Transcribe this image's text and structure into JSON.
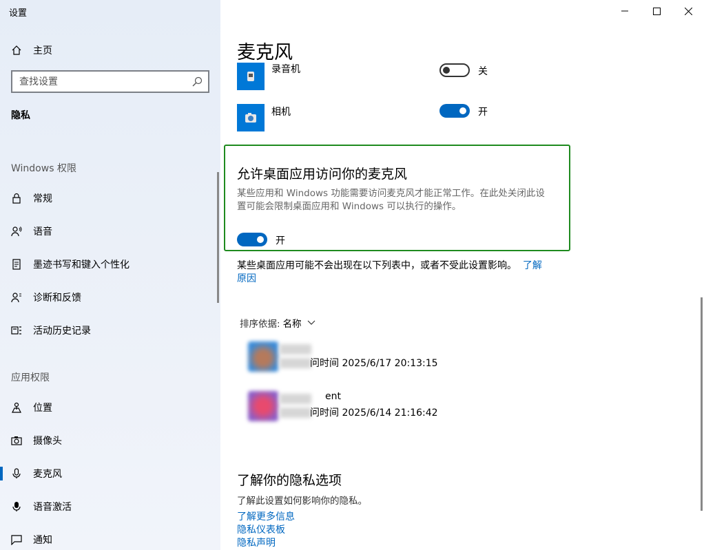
{
  "window": {
    "title": "设置"
  },
  "sidebar": {
    "home": "主页",
    "search_placeholder": "查找设置",
    "current_category": "隐私",
    "windows_perm_label": "Windows 权限",
    "windows_items": [
      "常规",
      "语音",
      "墨迹书写和键入个性化",
      "诊断和反馈",
      "活动历史记录"
    ],
    "app_perm_label": "应用权限",
    "app_items": [
      "位置",
      "摄像头",
      "麦克风",
      "语音激活",
      "通知"
    ],
    "selected_item": "麦克风"
  },
  "main": {
    "title": "麦克风",
    "store_apps": [
      {
        "name": "录音机",
        "state": "关",
        "on": false
      },
      {
        "name": "相机",
        "state": "开",
        "on": true
      }
    ],
    "desktop_section": {
      "heading": "允许桌面应用访问你的麦克风",
      "description": "某些应用和 Windows 功能需要访问麦克风才能正常工作。在此处关闭此设置可能会限制桌面应用和 Windows 可以执行的操作。",
      "toggle_state": "开",
      "toggle_on": true
    },
    "note_text": "某些桌面应用可能不会出现在以下列表中，或者不受此设置影响。",
    "note_link": "了解原因",
    "sort_label": "排序依据:",
    "sort_value": "名称",
    "desktop_apps": [
      {
        "name": "",
        "last_access": "问时间 2025/6/17 20:13:15"
      },
      {
        "name": "ent",
        "last_access": "问时间 2025/6/14 21:16:42"
      }
    ],
    "privacy_heading": "了解你的隐私选项",
    "privacy_text": "了解此设置如何影响你的隐私。",
    "privacy_links": [
      "了解更多信息",
      "隐私仪表板",
      "隐私声明"
    ]
  },
  "colors": {
    "accent": "#0067c0",
    "highlight_border": "#1e8a1e"
  }
}
